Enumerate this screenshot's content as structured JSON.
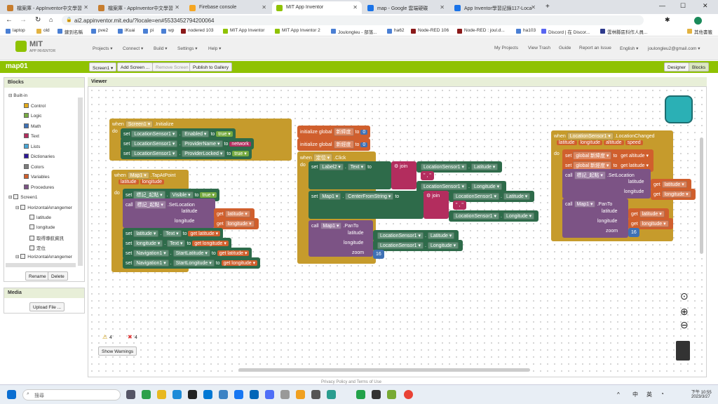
{
  "browser": {
    "tabs": [
      {
        "title": "檔案庫 - AppInventor中文學習",
        "active": false,
        "color": "#c77d2e"
      },
      {
        "title": "檔案庫 - AppInventor中文學習",
        "active": false,
        "color": "#c77d2e"
      },
      {
        "title": "Firebase console",
        "active": false,
        "color": "#f5a623"
      },
      {
        "title": "MIT App Inventor",
        "active": true,
        "color": "#8fc202"
      },
      {
        "title": "map - Google 雲端硬碟",
        "active": false,
        "color": "#1a73e8"
      },
      {
        "title": "App Inventor學習記錄117-Loca",
        "active": false,
        "color": "#1a73e8"
      }
    ],
    "url": "ai2.appinventor.mit.edu/?locale=en#5533452794200064",
    "bookmarks": [
      "laptop",
      "old",
      "鍵到名稱",
      "pve2",
      "iKuai",
      "pi",
      "wp",
      "nodered 103",
      "MIT App Inventor",
      "MIT App Inventor 2",
      "Joulongleu - 部落...",
      "ha62",
      "Node-RED 106",
      "Node-RED : joul.d...",
      "ha103",
      "Discord | 在 Discor...",
      "雲林縣區科作人員...",
      "其他書籤"
    ]
  },
  "app": {
    "logo_top": "MIT",
    "logo_bottom": "APP INVENTOR",
    "menu": [
      "Projects ▾",
      "Connect ▾",
      "Build ▾",
      "Settings ▾",
      "Help ▾"
    ],
    "right_menu": [
      "My Projects",
      "View Trash",
      "Guide",
      "Report an Issue",
      "English ▾",
      "joulongleu2@gmail.com ▾"
    ],
    "project": "map01",
    "screen_select": "Screen1 ▾",
    "add_screen": "Add Screen ...",
    "remove_screen": "Remove Screen",
    "publish": "Publish to Gallery",
    "designer": "Designer",
    "blocks_btn": "Blocks"
  },
  "blocks_panel": {
    "title": "Blocks",
    "builtin": "Built-in",
    "builtin_items": [
      {
        "label": "Control",
        "color": "#e1a91a"
      },
      {
        "label": "Logic",
        "color": "#77ab41"
      },
      {
        "label": "Math",
        "color": "#3f71b5"
      },
      {
        "label": "Text",
        "color": "#b32d5e"
      },
      {
        "label": "Lists",
        "color": "#49a6d4"
      },
      {
        "label": "Dictionaries",
        "color": "#2d1799"
      },
      {
        "label": "Colors",
        "color": "#7d7d7d"
      },
      {
        "label": "Variables",
        "color": "#d05f2d"
      },
      {
        "label": "Procedures",
        "color": "#7c5385"
      }
    ],
    "screen": "Screen1",
    "arrangement": "HorizontalArrangemer",
    "children": [
      "latitude",
      "longitude",
      "取得導航資訊",
      "定位"
    ],
    "arrangement2": "HorizontalArrangemer",
    "rename": "Rename",
    "delete": "Delete"
  },
  "media": {
    "title": "Media",
    "upload": "Upload File ..."
  },
  "viewer": {
    "title": "Viewer",
    "warnings_count": "4",
    "errors_count": "4",
    "show_warnings": "Show Warnings",
    "footer": "Privacy Policy and Terms of Use"
  },
  "blocks": {
    "init": {
      "when": "when",
      "comp": "Screen1 ▾",
      "event": ".Initialize",
      "do": "do",
      "l1": [
        "set",
        "LocationSensor1 ▾",
        "Enabled ▾",
        "to",
        "true ▾"
      ],
      "l2": [
        "set",
        "LocationSensor1 ▾",
        "ProviderName ▾",
        "to",
        "network"
      ],
      "l3": [
        "set",
        "LocationSensor1 ▾",
        "ProviderLocked ▾",
        "to",
        "true ▾"
      ]
    },
    "tap": {
      "when": "when",
      "comp": "Map1 ▾",
      "event": ".TapAtPoint",
      "p1": "latitude",
      "p2": "longitude",
      "do": "do",
      "l1": [
        "set",
        "標記_起點 ▾",
        "Visible ▾",
        "to",
        "true ▾"
      ],
      "call": [
        "call",
        "標記_起點 ▾",
        ".SetLocation"
      ],
      "lat": [
        "latitude",
        "get",
        "latitude ▾"
      ],
      "lon": [
        "longitude",
        "get",
        "longitude ▾"
      ],
      "l4": [
        "set",
        "latitude ▾",
        "Text ▾",
        "to",
        "get",
        "latitude ▾"
      ],
      "l5": [
        "set",
        "longitude ▾",
        "Text ▾",
        "to",
        "get",
        "longitude ▾"
      ],
      "l6": [
        "set",
        "Navigation1 ▾",
        "StartLatitude ▾",
        "to",
        "get",
        "latitude ▾"
      ],
      "l7": [
        "set",
        "Navigation1 ▾",
        "StartLongitude ▾",
        "to",
        "get",
        "longitude ▾"
      ]
    },
    "g1": [
      "initialize global",
      "新緯度",
      "to",
      "0"
    ],
    "g2": [
      "initialize global",
      "新經度",
      "to",
      "0"
    ],
    "click": {
      "when": "when",
      "comp": "定位 ▾",
      "event": ".Click",
      "do": "do",
      "s1": [
        "set",
        "Label2 ▾",
        "Text ▾",
        "to",
        "join"
      ],
      "j1": [
        "LocationSensor1 ▾",
        "Latitude ▾"
      ],
      "j2": "\" , \"",
      "j3": [
        "LocationSensor1 ▾",
        "Longitude ▾"
      ],
      "s2": [
        "set",
        "Map1 ▾",
        "CenterFromString ▾",
        "to",
        "join"
      ],
      "j4": [
        "LocationSensor1 ▾",
        "Latitude ▾"
      ],
      "j5": "\" , \"",
      "j6": [
        "LocationSensor1 ▾",
        "Longitude ▾"
      ],
      "pan": [
        "call",
        "Map1 ▾",
        ".PanTo"
      ],
      "pl": [
        "latitude",
        "LocationSensor1 ▾",
        "Latitude ▾"
      ],
      "pg": [
        "longitude",
        "LocationSensor1 ▾",
        "Longitude ▾"
      ],
      "pz": [
        "zoom",
        "16"
      ]
    },
    "lc": {
      "when": "when",
      "comp": "LocationSensor1 ▾",
      "event": ".LocationChanged",
      "params": [
        "latitude",
        "longitude",
        "altitude",
        "speed"
      ],
      "do": "do",
      "s1": [
        "set",
        "global 新緯度 ▾",
        "to",
        "get",
        "altitude ▾"
      ],
      "s2": [
        "set",
        "global 新經度 ▾",
        "to",
        "get",
        "latitude ▾"
      ],
      "c1": [
        "call",
        "標記_起點 ▾",
        ".SetLocation"
      ],
      "c1a": [
        "latitude",
        "get",
        "latitude ▾"
      ],
      "c1b": [
        "longitude",
        "get",
        "longitude ▾"
      ],
      "c2": [
        "call",
        "Map1 ▾",
        ".PanTo"
      ],
      "c2a": [
        "latitude",
        "get",
        "latitude ▾"
      ],
      "c2b": [
        "longitude",
        "get",
        "longitude ▾"
      ],
      "c2c": [
        "zoom",
        "16"
      ]
    }
  },
  "taskbar": {
    "search": "搜尋",
    "time": "下午 10:55",
    "date": "2023/3/27",
    "ime1": "中",
    "ime2": "英"
  }
}
